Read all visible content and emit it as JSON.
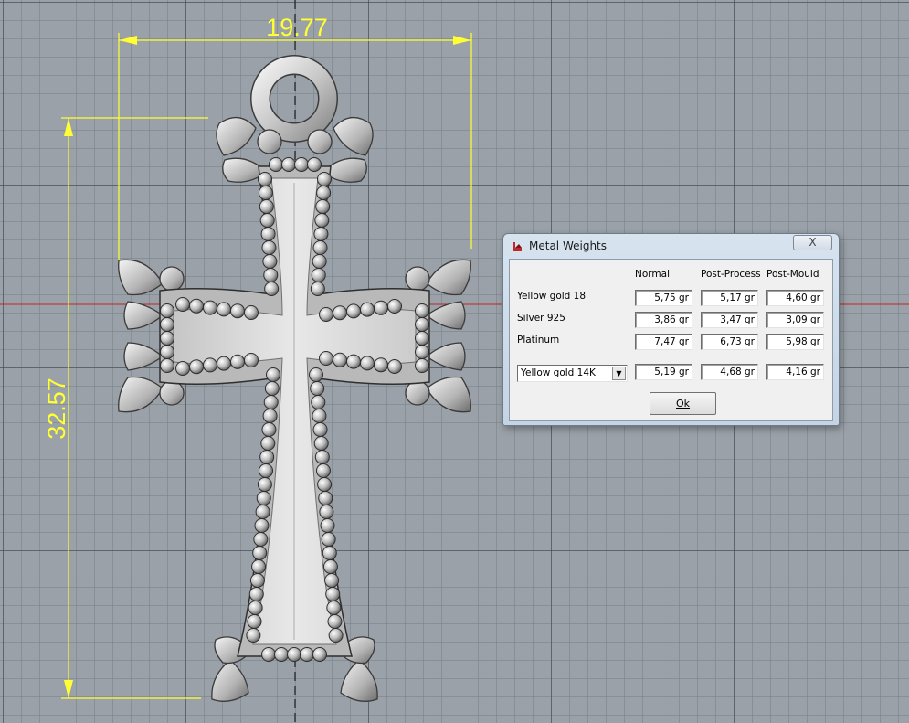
{
  "viewport": {
    "dimension_width": "19.77",
    "dimension_height": "32.57"
  },
  "dialog": {
    "title": "Metal Weights",
    "close_label": "X",
    "columns": [
      "Normal",
      "Post-Process",
      "Post-Mould"
    ],
    "rows": [
      {
        "label": "Yellow gold 18",
        "values": [
          "5,75 gr",
          "5,17 gr",
          "4,60 gr"
        ]
      },
      {
        "label": "Silver 925",
        "values": [
          "3,86 gr",
          "3,47 gr",
          "3,09 gr"
        ]
      },
      {
        "label": "Platinum",
        "values": [
          "7,47 gr",
          "6,73 gr",
          "5,98 gr"
        ]
      }
    ],
    "custom_row": {
      "selected_metal": "Yellow gold 14K",
      "values": [
        "5,19 gr",
        "4,68 gr",
        "4,16 gr"
      ]
    },
    "ok_label": "Ok"
  },
  "colors": {
    "dimension": "#ffff33",
    "grid_background": "#9aa1a8",
    "axis_x": "#c0262a"
  },
  "icons": [
    "dialog-app-icon",
    "close-icon",
    "chevron-down-icon"
  ]
}
